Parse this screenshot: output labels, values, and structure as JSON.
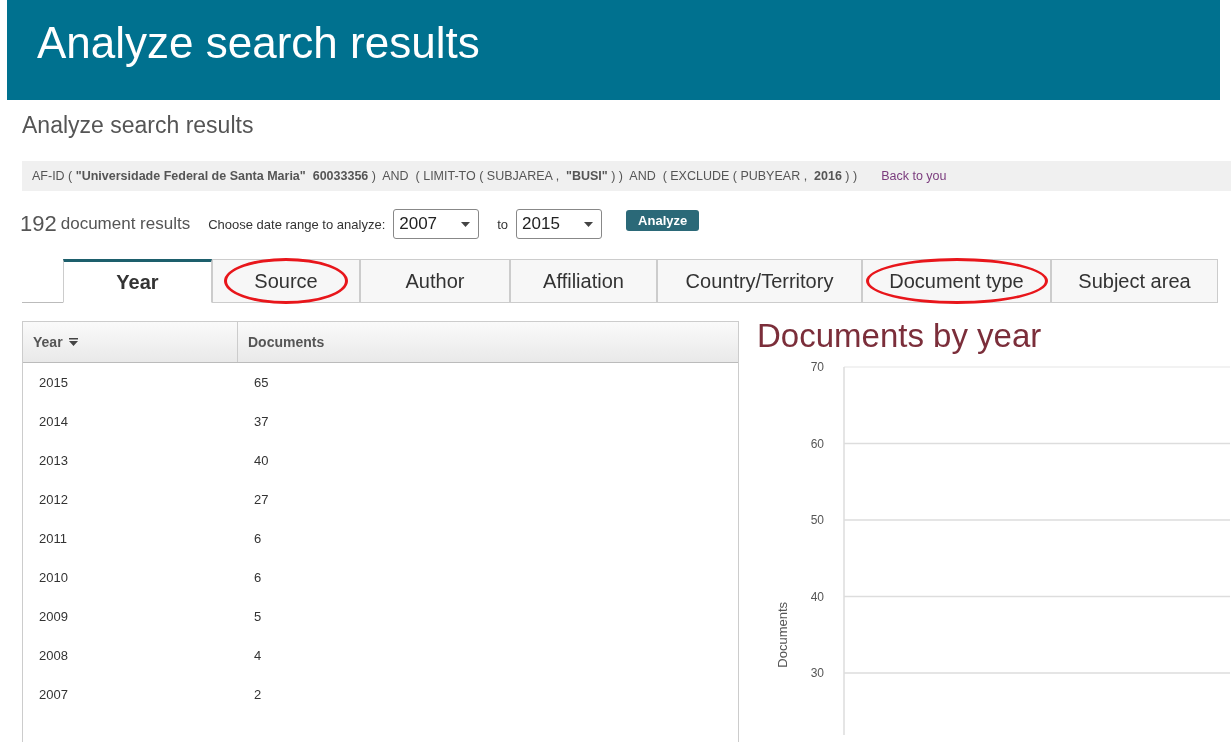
{
  "header": {
    "title": "Analyze search results"
  },
  "page_title": "Analyze search results",
  "query": {
    "text": "AF-ID ( **\"Universidade Federal de Santa Maria\"**  **60033356** )  AND  ( LIMIT-TO ( SUBJAREA ,  **\"BUSI\"** ) )  AND  ( EXCLUDE ( PUBYEAR ,  **2016** ) )",
    "link": "Back to you"
  },
  "results": {
    "count": "192",
    "count_label": "document results",
    "range_label": "Choose date range to analyze:",
    "from": "2007",
    "to_label": "to",
    "to": "2015",
    "button": "Analyze"
  },
  "tabs": [
    {
      "label": "Year",
      "selected": true,
      "circled": false
    },
    {
      "label": "Source",
      "selected": false,
      "circled": true
    },
    {
      "label": "Author",
      "selected": false,
      "circled": false
    },
    {
      "label": "Affiliation",
      "selected": false,
      "circled": false
    },
    {
      "label": "Country/Territory",
      "selected": false,
      "circled": false
    },
    {
      "label": "Document type",
      "selected": false,
      "circled": true
    },
    {
      "label": "Subject area",
      "selected": false,
      "circled": false
    }
  ],
  "table": {
    "columns": [
      "Year",
      "Documents"
    ],
    "rows": [
      [
        "2015",
        "65"
      ],
      [
        "2014",
        "37"
      ],
      [
        "2013",
        "40"
      ],
      [
        "2012",
        "27"
      ],
      [
        "2011",
        "6"
      ],
      [
        "2010",
        "6"
      ],
      [
        "2009",
        "5"
      ],
      [
        "2008",
        "4"
      ],
      [
        "2007",
        "2"
      ]
    ]
  },
  "chart": {
    "title": "Documents by year",
    "y_axis": {
      "label": "Documents",
      "ticks": [
        "70",
        "60",
        "50",
        "40",
        "30"
      ]
    }
  }
}
